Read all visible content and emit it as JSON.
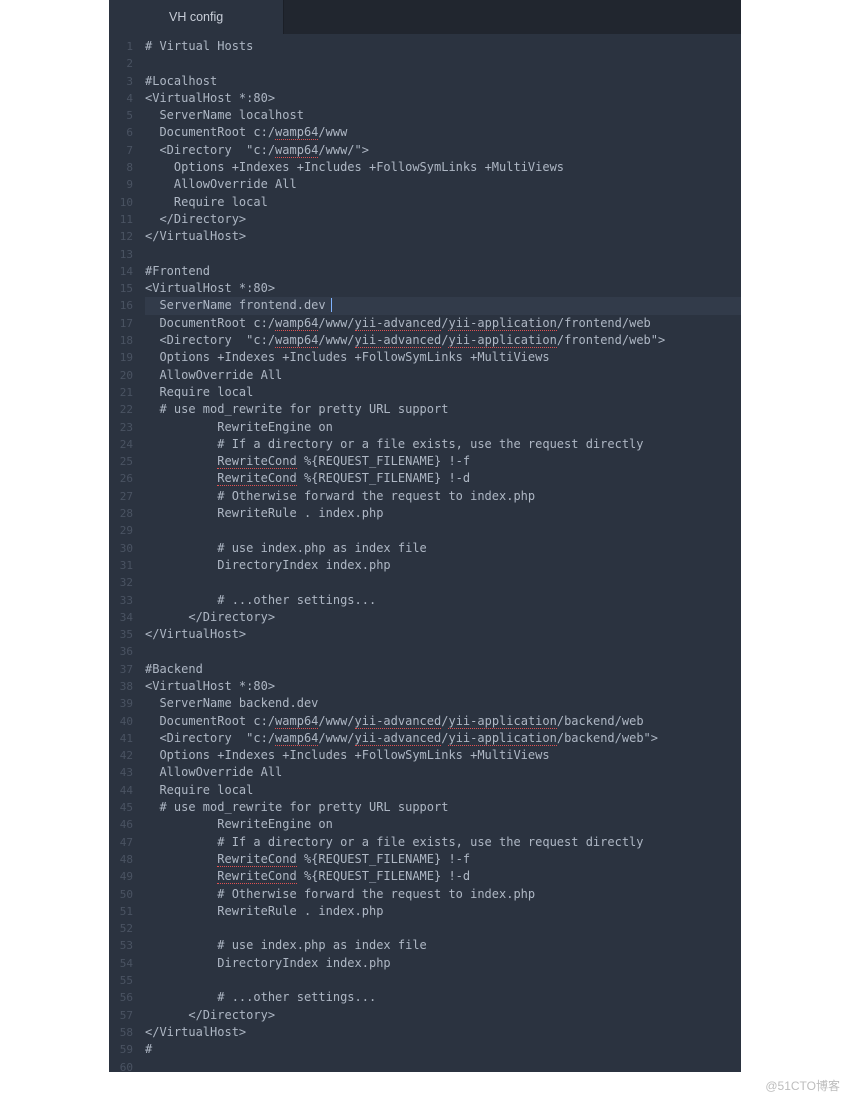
{
  "tab": {
    "title": "VH config"
  },
  "cursor_line": 16,
  "watermark": "@51CTO博客",
  "lines": [
    {
      "n": 1,
      "indent": 0,
      "segs": [
        {
          "t": "# Virtual Hosts"
        }
      ]
    },
    {
      "n": 2,
      "indent": 0,
      "segs": []
    },
    {
      "n": 3,
      "indent": 0,
      "segs": [
        {
          "t": "#Localhost"
        }
      ]
    },
    {
      "n": 4,
      "indent": 0,
      "segs": [
        {
          "t": "<VirtualHost *:80>"
        }
      ]
    },
    {
      "n": 5,
      "indent": 2,
      "segs": [
        {
          "t": "ServerName localhost"
        }
      ]
    },
    {
      "n": 6,
      "indent": 2,
      "segs": [
        {
          "t": "DocumentRoot c:/"
        },
        {
          "t": "wamp64",
          "sp": true
        },
        {
          "t": "/www"
        }
      ]
    },
    {
      "n": 7,
      "indent": 2,
      "segs": [
        {
          "t": "<Directory  \"c:/"
        },
        {
          "t": "wamp64",
          "sp": true
        },
        {
          "t": "/www/\">"
        }
      ]
    },
    {
      "n": 8,
      "indent": 4,
      "segs": [
        {
          "t": "Options +Indexes +Includes +FollowSymLinks +MultiViews"
        }
      ]
    },
    {
      "n": 9,
      "indent": 4,
      "segs": [
        {
          "t": "AllowOverride All"
        }
      ]
    },
    {
      "n": 10,
      "indent": 4,
      "segs": [
        {
          "t": "Require local"
        }
      ]
    },
    {
      "n": 11,
      "indent": 2,
      "segs": [
        {
          "t": "</Directory>"
        }
      ]
    },
    {
      "n": 12,
      "indent": 0,
      "segs": [
        {
          "t": "</VirtualHost>"
        }
      ]
    },
    {
      "n": 13,
      "indent": 0,
      "segs": []
    },
    {
      "n": 14,
      "indent": 0,
      "segs": [
        {
          "t": "#Frontend"
        }
      ]
    },
    {
      "n": 15,
      "indent": 0,
      "segs": [
        {
          "t": "<VirtualHost *:80>"
        }
      ]
    },
    {
      "n": 16,
      "indent": 2,
      "segs": [
        {
          "t": "ServerName frontend.dev"
        }
      ]
    },
    {
      "n": 17,
      "indent": 2,
      "segs": [
        {
          "t": "DocumentRoot c:/"
        },
        {
          "t": "wamp64",
          "sp": true
        },
        {
          "t": "/www/"
        },
        {
          "t": "yii-advanced",
          "sp": true
        },
        {
          "t": "/"
        },
        {
          "t": "yii-application",
          "sp": true
        },
        {
          "t": "/frontend/web"
        }
      ]
    },
    {
      "n": 18,
      "indent": 2,
      "segs": [
        {
          "t": "<Directory  \"c:/"
        },
        {
          "t": "wamp64",
          "sp": true
        },
        {
          "t": "/www/"
        },
        {
          "t": "yii-advanced",
          "sp": true
        },
        {
          "t": "/"
        },
        {
          "t": "yii-application",
          "sp": true
        },
        {
          "t": "/frontend/web\">"
        }
      ]
    },
    {
      "n": 19,
      "indent": 2,
      "segs": [
        {
          "t": "Options +Indexes +Includes +FollowSymLinks +MultiViews"
        }
      ]
    },
    {
      "n": 20,
      "indent": 2,
      "segs": [
        {
          "t": "AllowOverride All"
        }
      ]
    },
    {
      "n": 21,
      "indent": 2,
      "segs": [
        {
          "t": "Require local"
        }
      ]
    },
    {
      "n": 22,
      "indent": 2,
      "segs": [
        {
          "t": "# use mod_rewrite for pretty URL support"
        }
      ]
    },
    {
      "n": 23,
      "indent": 10,
      "segs": [
        {
          "t": "RewriteEngine on"
        }
      ]
    },
    {
      "n": 24,
      "indent": 10,
      "segs": [
        {
          "t": "# If a directory or a file exists, use the request directly"
        }
      ]
    },
    {
      "n": 25,
      "indent": 10,
      "segs": [
        {
          "t": "RewriteCond",
          "sp": true
        },
        {
          "t": " %{REQUEST_FILENAME} !-f"
        }
      ]
    },
    {
      "n": 26,
      "indent": 10,
      "segs": [
        {
          "t": "RewriteCond",
          "sp": true
        },
        {
          "t": " %{REQUEST_FILENAME} !-d"
        }
      ]
    },
    {
      "n": 27,
      "indent": 10,
      "segs": [
        {
          "t": "# Otherwise forward the request to index.php"
        }
      ]
    },
    {
      "n": 28,
      "indent": 10,
      "segs": [
        {
          "t": "RewriteRule . index.php"
        }
      ]
    },
    {
      "n": 29,
      "indent": 0,
      "segs": []
    },
    {
      "n": 30,
      "indent": 10,
      "segs": [
        {
          "t": "# use index.php as index file"
        }
      ]
    },
    {
      "n": 31,
      "indent": 10,
      "segs": [
        {
          "t": "DirectoryIndex index.php"
        }
      ]
    },
    {
      "n": 32,
      "indent": 0,
      "segs": []
    },
    {
      "n": 33,
      "indent": 10,
      "segs": [
        {
          "t": "# ...other settings..."
        }
      ]
    },
    {
      "n": 34,
      "indent": 6,
      "segs": [
        {
          "t": "</Directory>"
        }
      ]
    },
    {
      "n": 35,
      "indent": 0,
      "segs": [
        {
          "t": "</VirtualHost>"
        }
      ]
    },
    {
      "n": 36,
      "indent": 0,
      "segs": []
    },
    {
      "n": 37,
      "indent": 0,
      "segs": [
        {
          "t": "#Backend"
        }
      ]
    },
    {
      "n": 38,
      "indent": 0,
      "segs": [
        {
          "t": "<VirtualHost *:80>"
        }
      ]
    },
    {
      "n": 39,
      "indent": 2,
      "segs": [
        {
          "t": "ServerName backend.dev"
        }
      ]
    },
    {
      "n": 40,
      "indent": 2,
      "segs": [
        {
          "t": "DocumentRoot c:/"
        },
        {
          "t": "wamp64",
          "sp": true
        },
        {
          "t": "/www/"
        },
        {
          "t": "yii-advanced",
          "sp": true
        },
        {
          "t": "/"
        },
        {
          "t": "yii-application",
          "sp": true
        },
        {
          "t": "/backend/web"
        }
      ]
    },
    {
      "n": 41,
      "indent": 2,
      "segs": [
        {
          "t": "<Directory  \"c:/"
        },
        {
          "t": "wamp64",
          "sp": true
        },
        {
          "t": "/www/"
        },
        {
          "t": "yii-advanced",
          "sp": true
        },
        {
          "t": "/"
        },
        {
          "t": "yii-application",
          "sp": true
        },
        {
          "t": "/backend/web\">"
        }
      ]
    },
    {
      "n": 42,
      "indent": 2,
      "segs": [
        {
          "t": "Options +Indexes +Includes +FollowSymLinks +MultiViews"
        }
      ]
    },
    {
      "n": 43,
      "indent": 2,
      "segs": [
        {
          "t": "AllowOverride All"
        }
      ]
    },
    {
      "n": 44,
      "indent": 2,
      "segs": [
        {
          "t": "Require local"
        }
      ]
    },
    {
      "n": 45,
      "indent": 2,
      "segs": [
        {
          "t": "# use mod_rewrite for pretty URL support"
        }
      ]
    },
    {
      "n": 46,
      "indent": 10,
      "segs": [
        {
          "t": "RewriteEngine on"
        }
      ]
    },
    {
      "n": 47,
      "indent": 10,
      "segs": [
        {
          "t": "# If a directory or a file exists, use the request directly"
        }
      ]
    },
    {
      "n": 48,
      "indent": 10,
      "segs": [
        {
          "t": "RewriteCond",
          "sp": true
        },
        {
          "t": " %{REQUEST_FILENAME} !-f"
        }
      ]
    },
    {
      "n": 49,
      "indent": 10,
      "segs": [
        {
          "t": "RewriteCond",
          "sp": true
        },
        {
          "t": " %{REQUEST_FILENAME} !-d"
        }
      ]
    },
    {
      "n": 50,
      "indent": 10,
      "segs": [
        {
          "t": "# Otherwise forward the request to index.php"
        }
      ]
    },
    {
      "n": 51,
      "indent": 10,
      "segs": [
        {
          "t": "RewriteRule . index.php"
        }
      ]
    },
    {
      "n": 52,
      "indent": 0,
      "segs": []
    },
    {
      "n": 53,
      "indent": 10,
      "segs": [
        {
          "t": "# use index.php as index file"
        }
      ]
    },
    {
      "n": 54,
      "indent": 10,
      "segs": [
        {
          "t": "DirectoryIndex index.php"
        }
      ]
    },
    {
      "n": 55,
      "indent": 0,
      "segs": []
    },
    {
      "n": 56,
      "indent": 10,
      "segs": [
        {
          "t": "# ...other settings..."
        }
      ]
    },
    {
      "n": 57,
      "indent": 6,
      "segs": [
        {
          "t": "</Directory>"
        }
      ]
    },
    {
      "n": 58,
      "indent": 0,
      "segs": [
        {
          "t": "</VirtualHost>"
        }
      ]
    },
    {
      "n": 59,
      "indent": 0,
      "segs": [
        {
          "t": "#"
        }
      ]
    },
    {
      "n": 60,
      "indent": 0,
      "segs": []
    }
  ]
}
